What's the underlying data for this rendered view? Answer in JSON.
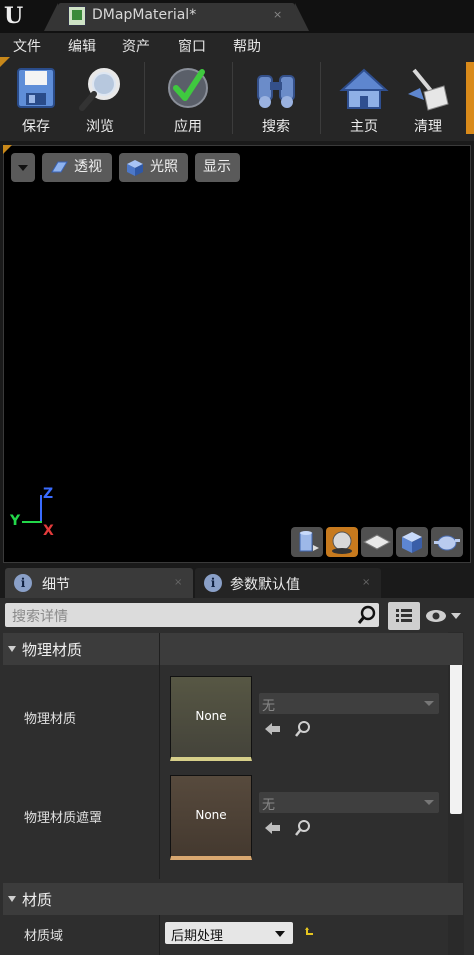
{
  "window": {
    "document_title": "DMapMaterial*",
    "close_glyph": "×"
  },
  "menu": {
    "items": [
      "文件",
      "编辑",
      "资产",
      "窗口",
      "帮助"
    ]
  },
  "toolbar": {
    "buttons": [
      {
        "label": "保存",
        "icon": "save-icon"
      },
      {
        "label": "浏览",
        "icon": "browse-icon"
      },
      {
        "label": "应用",
        "icon": "apply-icon"
      },
      {
        "label": "搜索",
        "icon": "binoculars-icon"
      },
      {
        "label": "主页",
        "icon": "home-icon"
      },
      {
        "label": "清理",
        "icon": "clean-icon"
      }
    ]
  },
  "viewport": {
    "buttons": {
      "perspective": "透视",
      "lighting": "光照",
      "show": "显示"
    },
    "axes": {
      "x": "X",
      "y": "Y",
      "z": "Z"
    }
  },
  "details": {
    "tabs": [
      {
        "label": "细节",
        "close": "×"
      },
      {
        "label": "参数默认值",
        "close": "×"
      }
    ],
    "search_placeholder": "搜索详情",
    "categories": {
      "physical_material": {
        "title": "物理材质",
        "props": [
          {
            "label": "物理材质",
            "thumb": "None",
            "combo": "无"
          },
          {
            "label": "物理材质遮罩",
            "thumb": "None",
            "combo": "无"
          }
        ]
      },
      "material": {
        "title": "材质",
        "props": [
          {
            "label": "材质域",
            "value": "后期处理"
          }
        ]
      }
    }
  }
}
